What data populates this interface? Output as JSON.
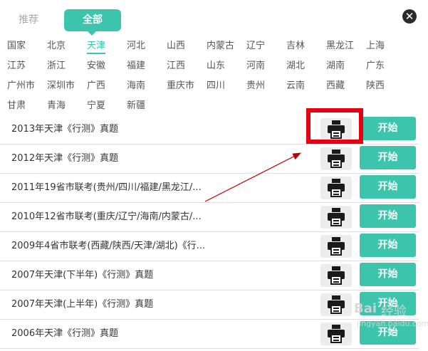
{
  "tabs": {
    "recommend": "推荐",
    "all": "全部"
  },
  "close_glyph": "✕",
  "regions": [
    {
      "label": "国家"
    },
    {
      "label": "北京"
    },
    {
      "label": "天津",
      "active": true
    },
    {
      "label": "河北"
    },
    {
      "label": "山西"
    },
    {
      "label": "内蒙古"
    },
    {
      "label": "辽宁"
    },
    {
      "label": "吉林"
    },
    {
      "label": "黑龙江"
    },
    {
      "label": "上海"
    },
    {
      "label": "江苏"
    },
    {
      "label": "浙江"
    },
    {
      "label": "安徽"
    },
    {
      "label": "福建"
    },
    {
      "label": "江西"
    },
    {
      "label": "山东"
    },
    {
      "label": "河南"
    },
    {
      "label": "湖北"
    },
    {
      "label": "湖南"
    },
    {
      "label": "广东"
    },
    {
      "label": "广州市"
    },
    {
      "label": "深圳市"
    },
    {
      "label": "广西"
    },
    {
      "label": "海南"
    },
    {
      "label": "重庆市"
    },
    {
      "label": "四川"
    },
    {
      "label": "贵州"
    },
    {
      "label": "云南"
    },
    {
      "label": "西藏"
    },
    {
      "label": "陕西"
    },
    {
      "label": "甘肃"
    },
    {
      "label": "青海"
    },
    {
      "label": "宁夏"
    },
    {
      "label": "新疆"
    }
  ],
  "exams": [
    {
      "title": "2013年天津《行测》真题",
      "start_label": "开始"
    },
    {
      "title": "2012年天津《行测》真题",
      "start_label": "开始"
    },
    {
      "title": "2011年19省市联考(贵州/四川/福建/黑龙江/...",
      "start_label": "开始"
    },
    {
      "title": "2010年12省市联考(重庆/辽宁/海南/内蒙古/...",
      "start_label": "开始"
    },
    {
      "title": "2009年4省市联考(西藏/陕西/天津/湖北)《行...",
      "start_label": "开始"
    },
    {
      "title": "2007年天津(下半年)《行测》真题",
      "start_label": "开始"
    },
    {
      "title": "2007年天津(上半年)《行测》真题",
      "start_label": "开始"
    },
    {
      "title": "2006年天津《行测》真题",
      "start_label": "开始"
    }
  ],
  "icons": {
    "print": "printer-icon",
    "close": "close-icon"
  },
  "colors": {
    "accent": "#3cc4ad",
    "highlight": "#e60012",
    "arrow": "#c00000"
  },
  "watermark": {
    "logo": "Bai",
    "text": "经验",
    "url": "jingyan.baidu.com"
  }
}
